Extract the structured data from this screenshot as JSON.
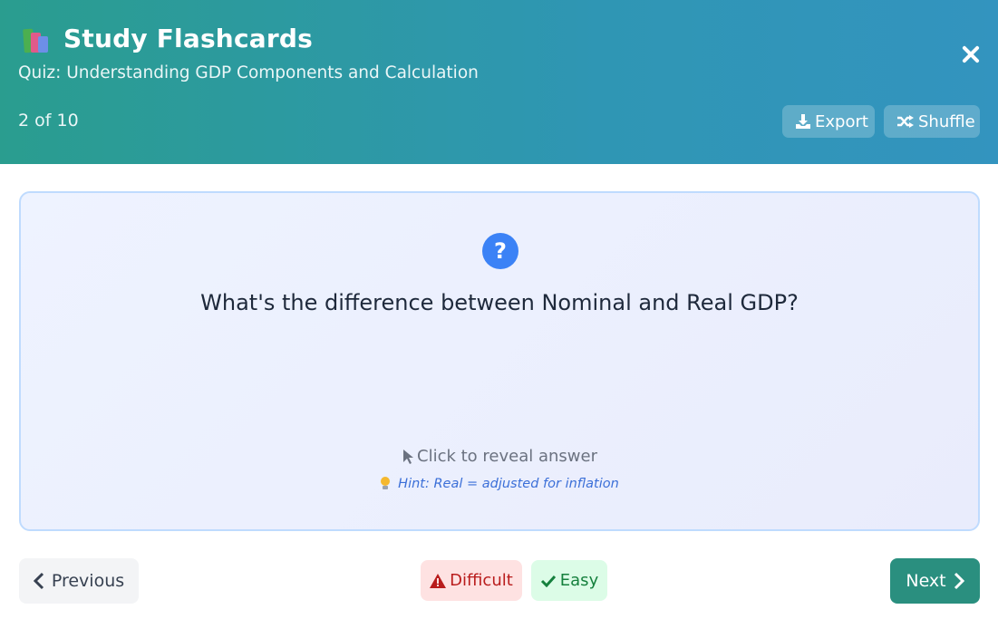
{
  "header": {
    "title": "Study Flashcards",
    "title_icon": "books-icon",
    "subtitle": "Quiz: Understanding GDP Components and Calculation",
    "counter": "2 of 10",
    "export_label": "Export",
    "shuffle_label": "Shuffle"
  },
  "card": {
    "question": "What's the difference between Nominal and Real GDP?",
    "reveal_label": "Click to reveal answer",
    "hint": "Hint: Real = adjusted for inflation"
  },
  "footer": {
    "previous_label": "Previous",
    "difficult_label": "Difficult",
    "easy_label": "Easy",
    "next_label": "Next"
  },
  "colors": {
    "header_gradient_start": "#2a9d8f",
    "header_gradient_end": "#3394bf",
    "accent": "#3b82f6",
    "next_button": "#2a8f7f",
    "difficult": "#b91c1c",
    "easy": "#15803d"
  }
}
